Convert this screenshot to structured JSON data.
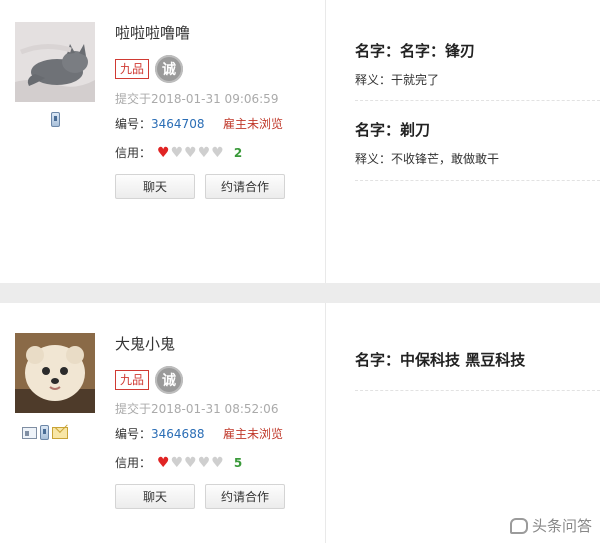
{
  "posts": [
    {
      "username": "啦啦啦噜噜",
      "rank_badge": "九品",
      "honesty_badge": "诚",
      "submit_time": "提交于2018-01-31 09:06:59",
      "id_label": "编号：",
      "id_value": "3464708",
      "status": "雇主未浏览",
      "credit_label": "信用：",
      "credit_hearts": 1,
      "credit_value": "2",
      "chat_button": "聊天",
      "invite_button": "约请合作",
      "contact_icons": [
        "phone-icon"
      ],
      "names": [
        {
          "title": "名字：名字：锋刃",
          "meaning": "释义：干就完了"
        },
        {
          "title": "名字：剃刀",
          "meaning": "释义：不收锋芒，敢做敢干"
        }
      ]
    },
    {
      "username": "大鬼小鬼",
      "rank_badge": "九品",
      "honesty_badge": "诚",
      "submit_time": "提交于2018-01-31 08:52:06",
      "id_label": "编号：",
      "id_value": "3464688",
      "status": "雇主未浏览",
      "credit_label": "信用：",
      "credit_hearts": 1,
      "credit_value": "5",
      "chat_button": "聊天",
      "invite_button": "约请合作",
      "contact_icons": [
        "id-card-icon",
        "phone-icon",
        "mail-icon"
      ],
      "names": [
        {
          "title": "名字：中保科技 黑豆科技",
          "meaning": ""
        }
      ]
    }
  ],
  "watermark": "头条问答",
  "colors": {
    "accent_red": "#d03a33",
    "link_blue": "#2a6db5",
    "credit_green": "#3a9a3a",
    "heart_red": "#e02424"
  }
}
